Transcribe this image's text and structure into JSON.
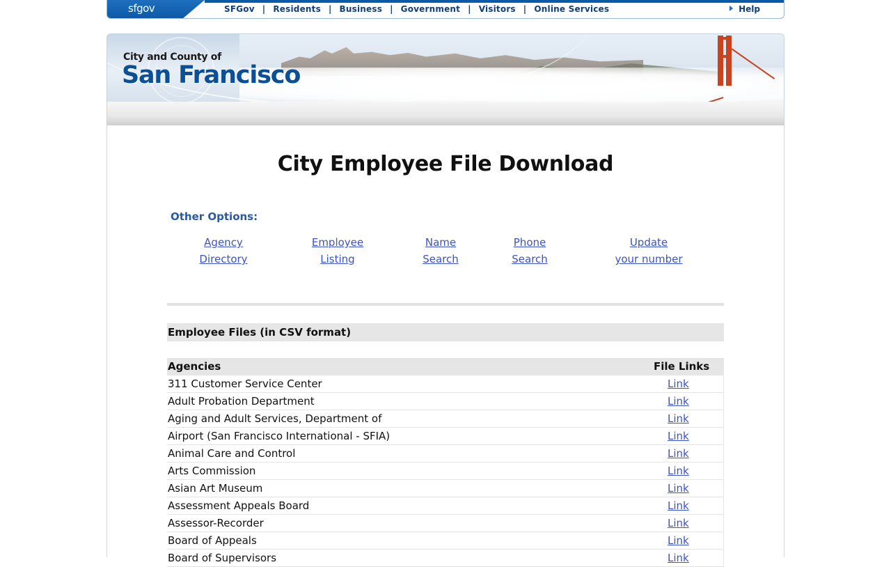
{
  "topnav": {
    "logo": "sfgov",
    "items": [
      "SFGov",
      "Residents",
      "Business",
      "Government",
      "Visitors",
      "Online Services"
    ],
    "separator": "|",
    "help": "Help"
  },
  "banner": {
    "line1": "City and County of",
    "line2": "San Francisco"
  },
  "page": {
    "title": "City Employee File Download",
    "other_options_label": "Other Options:",
    "options": [
      {
        "line1": "Agency",
        "line2": "Directory"
      },
      {
        "line1": "Employee",
        "line2": "Listing"
      },
      {
        "line1": "Name",
        "line2": "Search"
      },
      {
        "line1": "Phone",
        "line2": "Search"
      },
      {
        "line1": "Update",
        "line2": "your number"
      }
    ],
    "section_title": "Employee Files (in CSV format)"
  },
  "table": {
    "col_agencies": "Agencies",
    "col_file_links": "File Links",
    "link_label": "Link",
    "rows": [
      "311 Customer Service Center",
      "Adult Probation Department",
      "Aging and Adult Services, Department of",
      "Airport (San Francisco International - SFIA)",
      "Animal Care and Control",
      "Arts Commission",
      "Asian Art Museum",
      "Assessment Appeals Board",
      "Assessor-Recorder",
      "Board of Appeals",
      "Board of Supervisors"
    ]
  },
  "colors": {
    "brand_blue": "#0b5aa8",
    "link": "#3a53c6",
    "heading_blue": "#2b5aa0"
  }
}
